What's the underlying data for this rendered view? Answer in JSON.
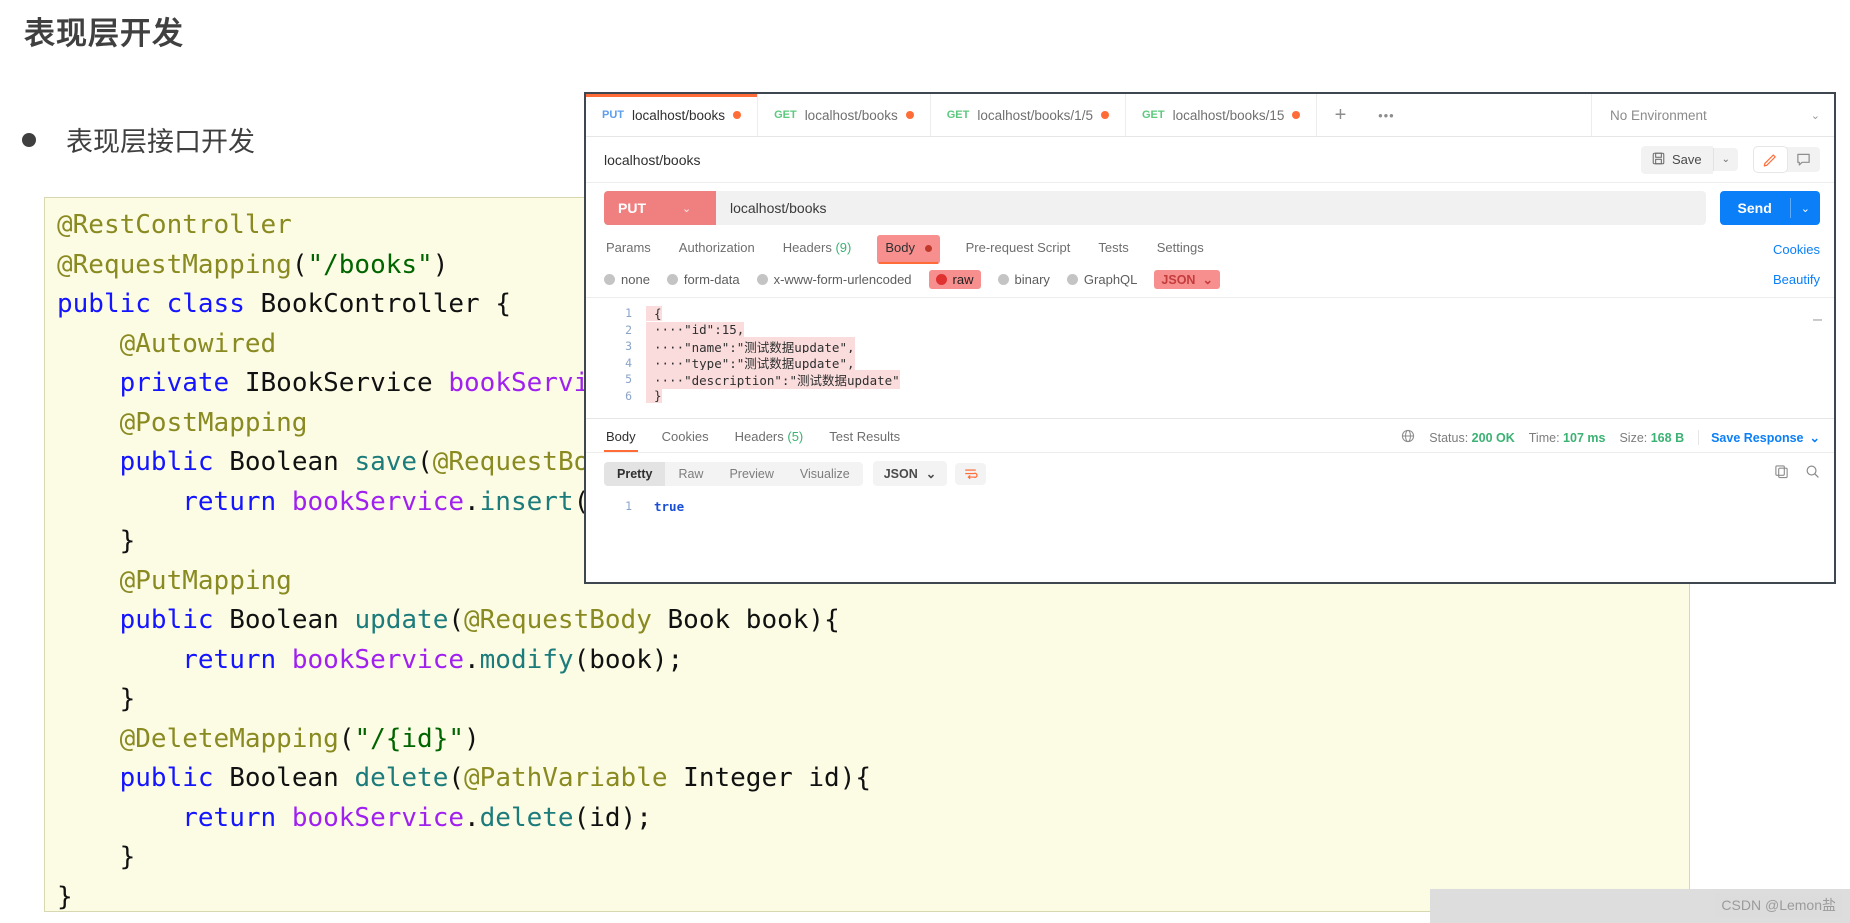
{
  "slide": {
    "title": "表现层开发",
    "bullet": "表现层接口开发"
  },
  "code": {
    "lines": [
      "@RestController",
      "@RequestMapping(\"/books\")",
      "public class BookController {",
      "    @Autowired",
      "    private IBookService bookService;",
      "    @PostMapping",
      "    public Boolean save(@RequestBody Book book){",
      "        return bookService.insert(book);",
      "    }",
      "    @PutMapping",
      "    public Boolean update(@RequestBody Book book){",
      "        return bookService.modify(book);",
      "    }",
      "    @DeleteMapping(\"/{id}\")",
      "    public Boolean delete(@PathVariable Integer id){",
      "        return bookService.delete(id);",
      "    }",
      "}"
    ]
  },
  "postman": {
    "tabs": [
      {
        "method": "PUT",
        "url": "localhost/books",
        "unsaved": true,
        "active": true
      },
      {
        "method": "GET",
        "url": "localhost/books",
        "unsaved": true,
        "active": false
      },
      {
        "method": "GET",
        "url": "localhost/books/1/5",
        "unsaved": true,
        "active": false
      },
      {
        "method": "GET",
        "url": "localhost/books/15",
        "unsaved": true,
        "active": false
      }
    ],
    "tab_add_label": "+",
    "tab_more_label": "•••",
    "environment": "No Environment",
    "request_name": "localhost/books",
    "save_label": "Save",
    "save_caret": "⌄",
    "method": "PUT",
    "method_caret": "⌄",
    "url": "localhost/books",
    "send_label": "Send",
    "send_caret": "⌄",
    "request_tabs": [
      {
        "label": "Params",
        "active": false
      },
      {
        "label": "Authorization",
        "active": false
      },
      {
        "label": "Headers",
        "count": "(9)",
        "active": false
      },
      {
        "label": "Body",
        "active": true,
        "dot": true
      },
      {
        "label": "Pre-request Script",
        "active": false
      },
      {
        "label": "Tests",
        "active": false
      },
      {
        "label": "Settings",
        "active": false
      }
    ],
    "cookies_link": "Cookies",
    "body_types": [
      {
        "label": "none",
        "selected": false
      },
      {
        "label": "form-data",
        "selected": false
      },
      {
        "label": "x-www-form-urlencoded",
        "selected": false
      },
      {
        "label": "raw",
        "selected": true
      },
      {
        "label": "binary",
        "selected": false
      },
      {
        "label": "GraphQL",
        "selected": false
      }
    ],
    "body_format": "JSON",
    "body_format_caret": "⌄",
    "beautify_label": "Beautify",
    "editor": {
      "minus": "—",
      "lines": [
        {
          "n": "1",
          "text": "{"
        },
        {
          "n": "2",
          "text": "····\"id\":15,"
        },
        {
          "n": "3",
          "text": "····\"name\":\"测试数据update\","
        },
        {
          "n": "4",
          "text": "····\"type\":\"测试数据update\","
        },
        {
          "n": "5",
          "text": "····\"description\":\"测试数据update\""
        },
        {
          "n": "6",
          "text": "}"
        }
      ]
    },
    "response_tabs": [
      {
        "label": "Body",
        "active": true
      },
      {
        "label": "Cookies",
        "active": false
      },
      {
        "label": "Headers",
        "count": "(5)",
        "active": false
      },
      {
        "label": "Test Results",
        "active": false
      }
    ],
    "response_stats": {
      "status_label": "Status:",
      "status_value": "200 OK",
      "time_label": "Time:",
      "time_value": "107 ms",
      "size_label": "Size:",
      "size_value": "168 B",
      "save_response": "Save Response",
      "save_response_caret": "⌄"
    },
    "view_modes": [
      {
        "label": "Pretty",
        "active": true
      },
      {
        "label": "Raw",
        "active": false
      },
      {
        "label": "Preview",
        "active": false
      },
      {
        "label": "Visualize",
        "active": false
      }
    ],
    "response_format": "JSON",
    "response_format_caret": "⌄",
    "response_body": {
      "line_no": "1",
      "text": "true"
    }
  },
  "watermark": "CSDN @Lemon盐",
  "colors": {
    "orange_accent": "#ff6c37",
    "send_blue": "#0b7ff7",
    "put_red": "#f07f7f",
    "green": "#3bb273",
    "code_bg": "#fcfce5"
  }
}
